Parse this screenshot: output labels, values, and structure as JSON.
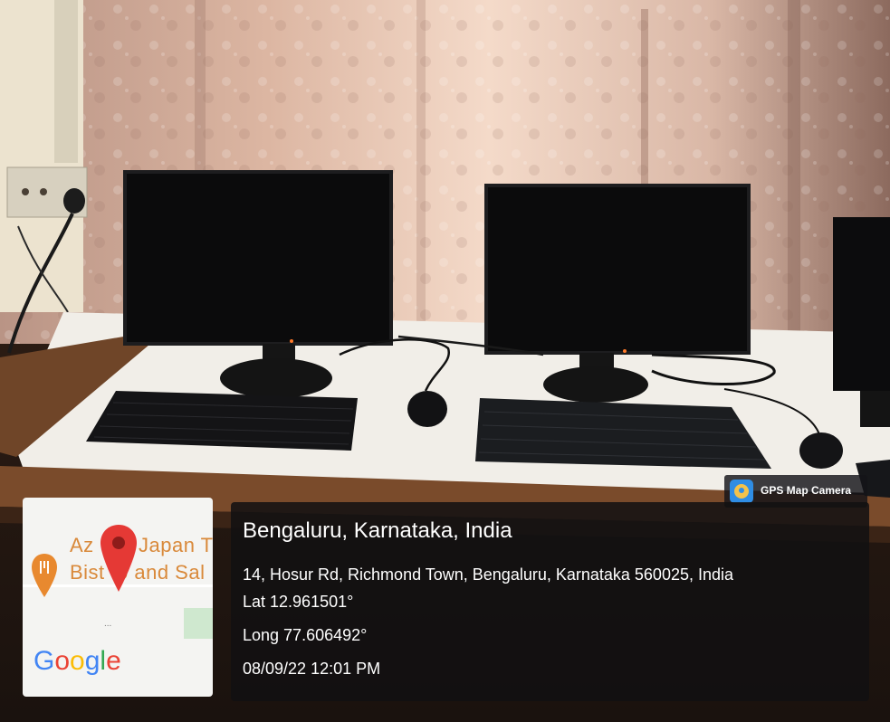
{
  "overlay": {
    "badge": {
      "label": "GPS Map Camera",
      "icon": "gps-map-camera-app-icon"
    },
    "location_title": "Bengaluru, Karnataka, India",
    "address": "14, Hosur Rd, Richmond Town, Bengaluru, Karnataka 560025, India",
    "latitude": "Lat 12.961501°",
    "longitude": "Long 77.606492°",
    "timestamp": "08/09/22 12:01 PM"
  },
  "map": {
    "poi_line1_a": "Az",
    "poi_line1_b": "Japan T",
    "poi_line2_a": "Bist",
    "poi_line2_b": "o and Sal",
    "ellipsis": "...",
    "google_logo": "Google",
    "pin_icon": "map-pin-icon",
    "poi_icon": "restaurant-icon"
  },
  "colors": {
    "google": [
      "#4285F4",
      "#EA4335",
      "#FBBC05",
      "#4285F4",
      "#34A853",
      "#EA4335"
    ],
    "pin": "#e53935",
    "poi": "#e8892f",
    "panel": "#121012"
  }
}
